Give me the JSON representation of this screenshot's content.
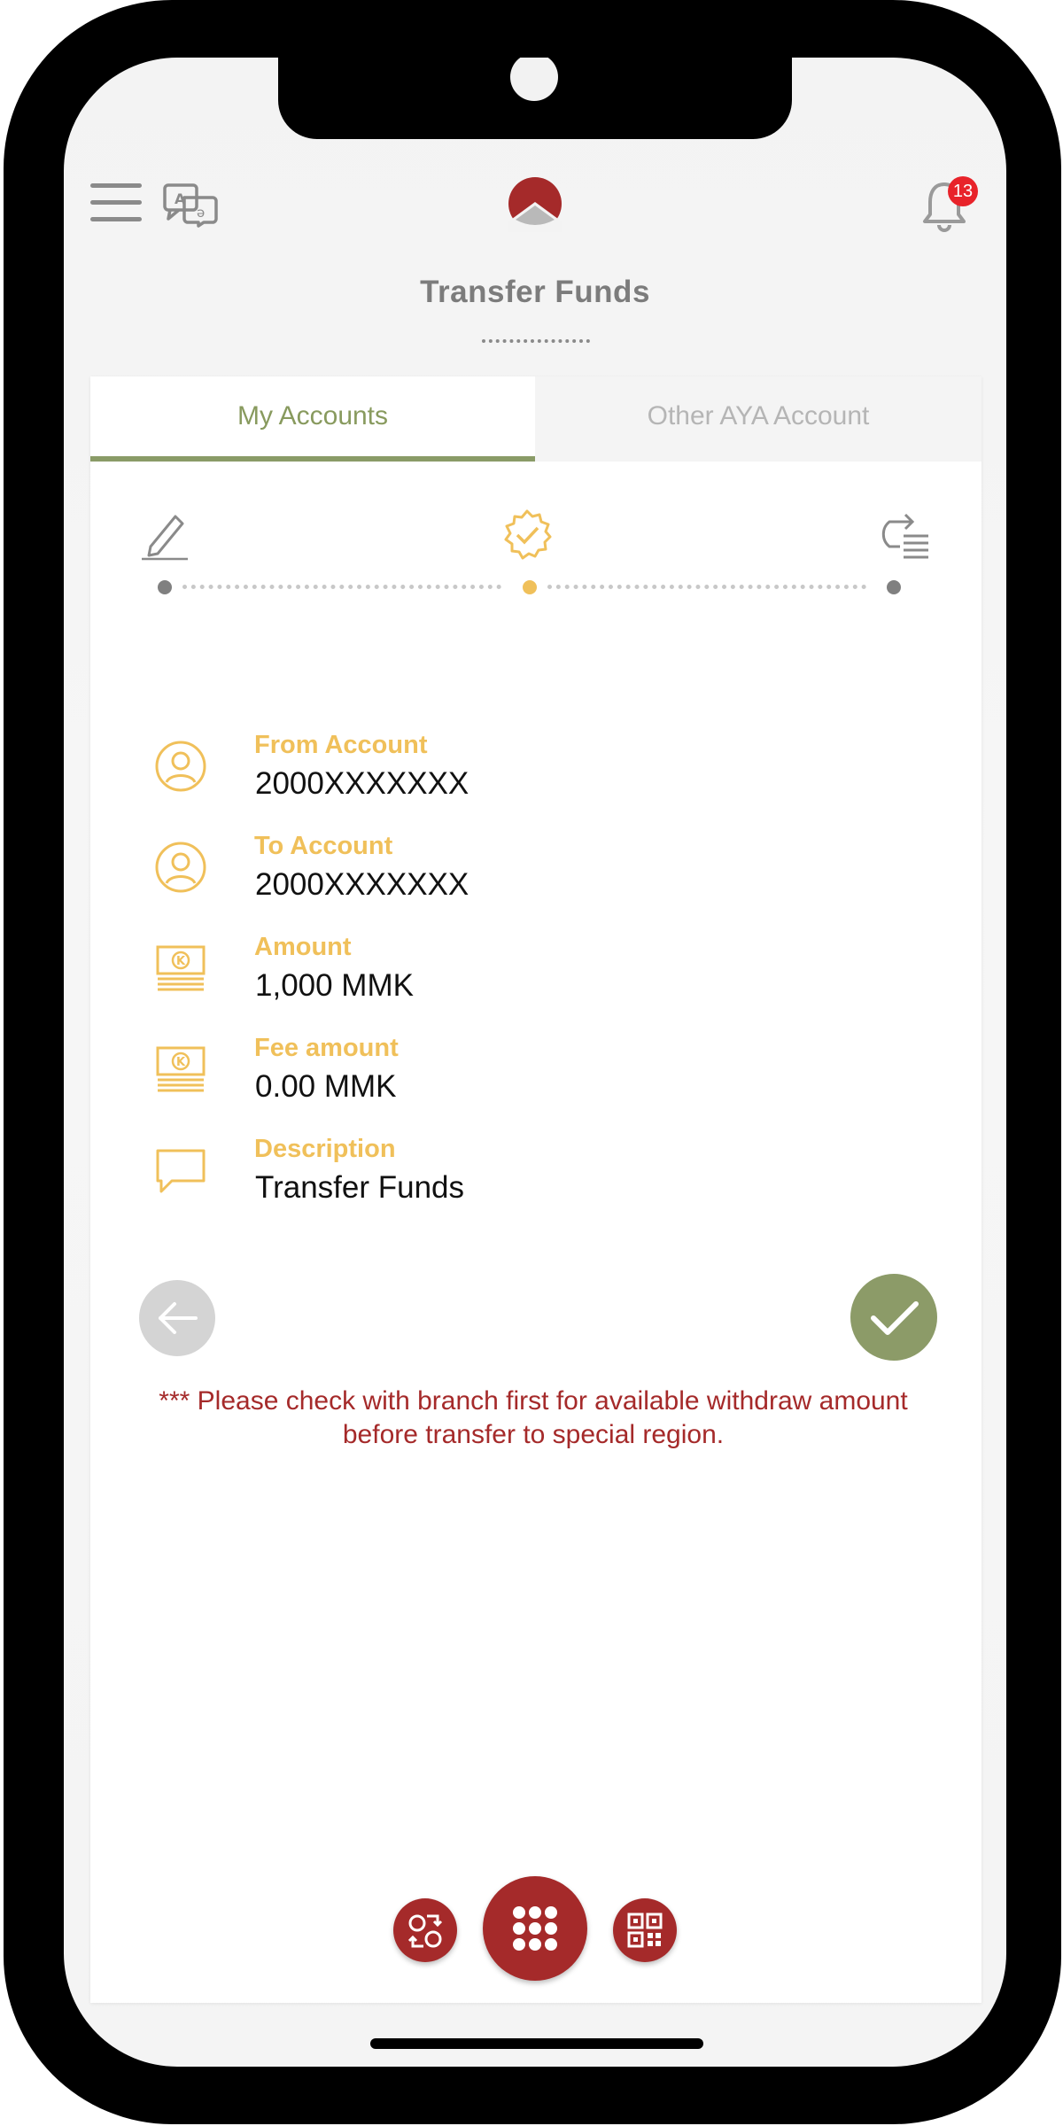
{
  "header": {
    "title": "Transfer Funds",
    "notification_count": "13"
  },
  "tabs": [
    {
      "label": "My Accounts",
      "active": true
    },
    {
      "label": "Other AYA Account",
      "active": false
    }
  ],
  "stepper": {
    "steps": [
      "edit",
      "confirm",
      "result"
    ],
    "current_step": 2
  },
  "details": [
    {
      "label": "From Account",
      "value": "2000XXXXXXX",
      "icon": "user-circle-icon"
    },
    {
      "label": "To Account",
      "value": "2000XXXXXXX",
      "icon": "user-circle-icon"
    },
    {
      "label": "Amount",
      "value": "1,000 MMK",
      "icon": "money-icon"
    },
    {
      "label": "Fee amount",
      "value": "0.00 MMK",
      "icon": "money-icon"
    },
    {
      "label": "Description",
      "value": "Transfer Funds",
      "icon": "chat-bubble-icon"
    }
  ],
  "notice": "*** Please check with branch first for available withdraw amount before transfer to special region.",
  "colors": {
    "brand_red": "#a52a2a",
    "accent_green": "#8c9b68",
    "label_gold": "#f0c05a",
    "notice_red": "#a52a2a"
  }
}
